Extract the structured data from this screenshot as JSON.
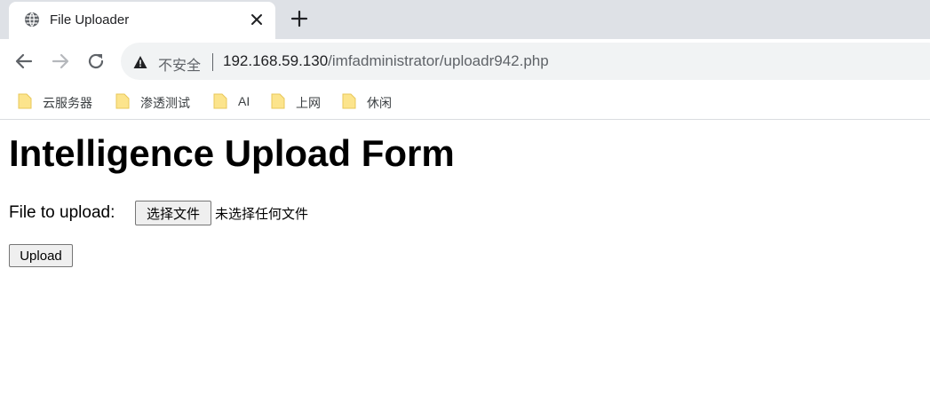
{
  "browser": {
    "tab": {
      "title": "File Uploader",
      "favicon_icon": "globe-icon",
      "close_icon": "close-icon"
    },
    "new_tab_icon": "plus-icon",
    "nav": {
      "back_icon": "arrow-left-icon",
      "forward_icon": "arrow-right-icon",
      "reload_icon": "reload-icon"
    },
    "omnibox": {
      "security_icon": "warning-icon",
      "security_label": "不安全",
      "url_host": "192.168.59.130",
      "url_path": "/imfadministrator/uploadr942.php"
    },
    "bookmarks": [
      {
        "label": "云服务器",
        "icon": "folder-icon"
      },
      {
        "label": "渗透测试",
        "icon": "folder-icon"
      },
      {
        "label": "AI",
        "icon": "folder-icon"
      },
      {
        "label": "上网",
        "icon": "folder-icon"
      },
      {
        "label": "休闲",
        "icon": "folder-icon"
      }
    ]
  },
  "page": {
    "title": "Intelligence Upload Form",
    "file_label": "File to upload:",
    "choose_file_label": "选择文件",
    "no_file_text": "未选择任何文件",
    "upload_label": "Upload"
  },
  "colors": {
    "tabstrip_bg": "#dee1e6",
    "omnibox_bg": "#f1f3f4",
    "folder_yellow": "#fce48c",
    "text_primary": "#202124",
    "text_secondary": "#5f6368"
  }
}
